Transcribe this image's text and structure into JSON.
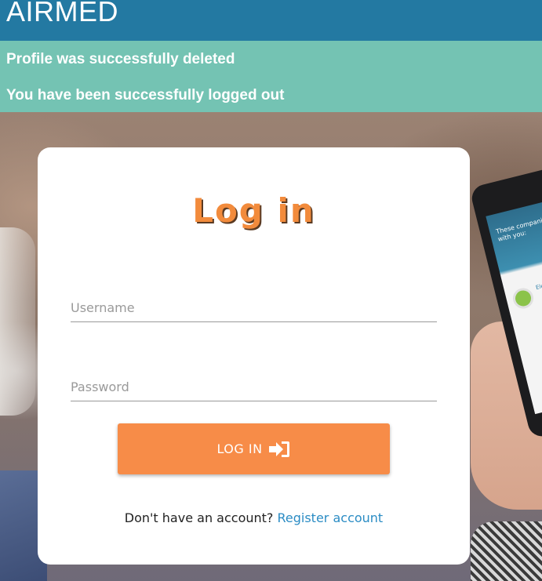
{
  "header": {
    "brand": "AIRMED"
  },
  "alerts": [
    {
      "text": "Profile was successfully deleted"
    },
    {
      "text": "You have been successfully logged out"
    }
  ],
  "login_card": {
    "title": "Log in",
    "username": {
      "placeholder": "Username",
      "value": ""
    },
    "password": {
      "placeholder": "Password",
      "value": ""
    },
    "submit_label": "LOG IN",
    "submit_icon": "sign-in-icon",
    "register_prompt": "Don't have an account?",
    "register_link": "Register account"
  },
  "background": {
    "phone_screen_text": "These companies w... with you:",
    "phone_screen_label": "Eleme..."
  },
  "colors": {
    "header_bg": "#2379a2",
    "alert_bg": "#74c3b3",
    "accent_orange": "#f78c48",
    "link_blue": "#2b8cc4"
  }
}
